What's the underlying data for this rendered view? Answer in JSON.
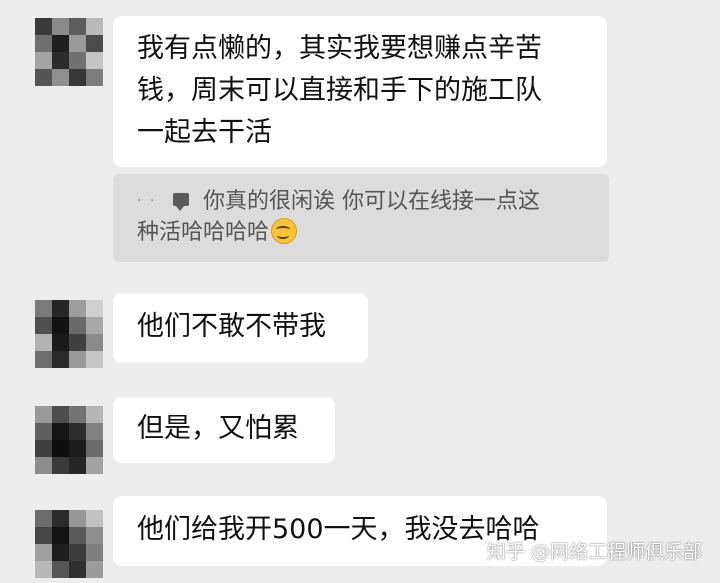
{
  "messages": [
    {
      "lines": [
        "我有点懒的，其实我要想赚点辛苦",
        "钱，周末可以直接和手下的施工队",
        "一起去干活"
      ]
    },
    {
      "lines": [
        "他们不敢不带我"
      ]
    },
    {
      "lines": [
        "但是，又怕累"
      ]
    },
    {
      "lines": [
        "他们给我开500一天，我没去哈哈"
      ]
    }
  ],
  "quote": {
    "sender": "· ·",
    "line1": "你真的很闲诶 你可以在线接一点这",
    "line2": "种活哈哈哈哈",
    "icon": "chat-bubble-icon",
    "emoji": "smiling-face-with-sunglasses-emoji"
  },
  "watermark": "知乎 @网络工程师俱乐部",
  "colors": {
    "background": "#ededed",
    "bubble": "#ffffff",
    "quote_background": "#dcdcdc"
  }
}
